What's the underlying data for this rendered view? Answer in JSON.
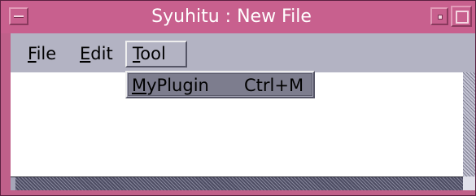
{
  "window": {
    "title": "Syuhitu : New File"
  },
  "menubar": {
    "items": [
      {
        "label": "File",
        "mnemonic": "F",
        "rest": "ile"
      },
      {
        "label": "Edit",
        "mnemonic": "E",
        "rest": "dit"
      },
      {
        "label": "Tool",
        "mnemonic": "T",
        "rest": "ool",
        "open": true
      }
    ]
  },
  "dropdown": {
    "items": [
      {
        "label": "MyPlugin",
        "mnemonic": "M",
        "rest": "yPlugin",
        "accelerator": "Ctrl+M"
      }
    ]
  },
  "colors": {
    "titlebar": "#c8608e",
    "menubar": "#b3b3c3",
    "highlight": "#7d7d8e"
  }
}
